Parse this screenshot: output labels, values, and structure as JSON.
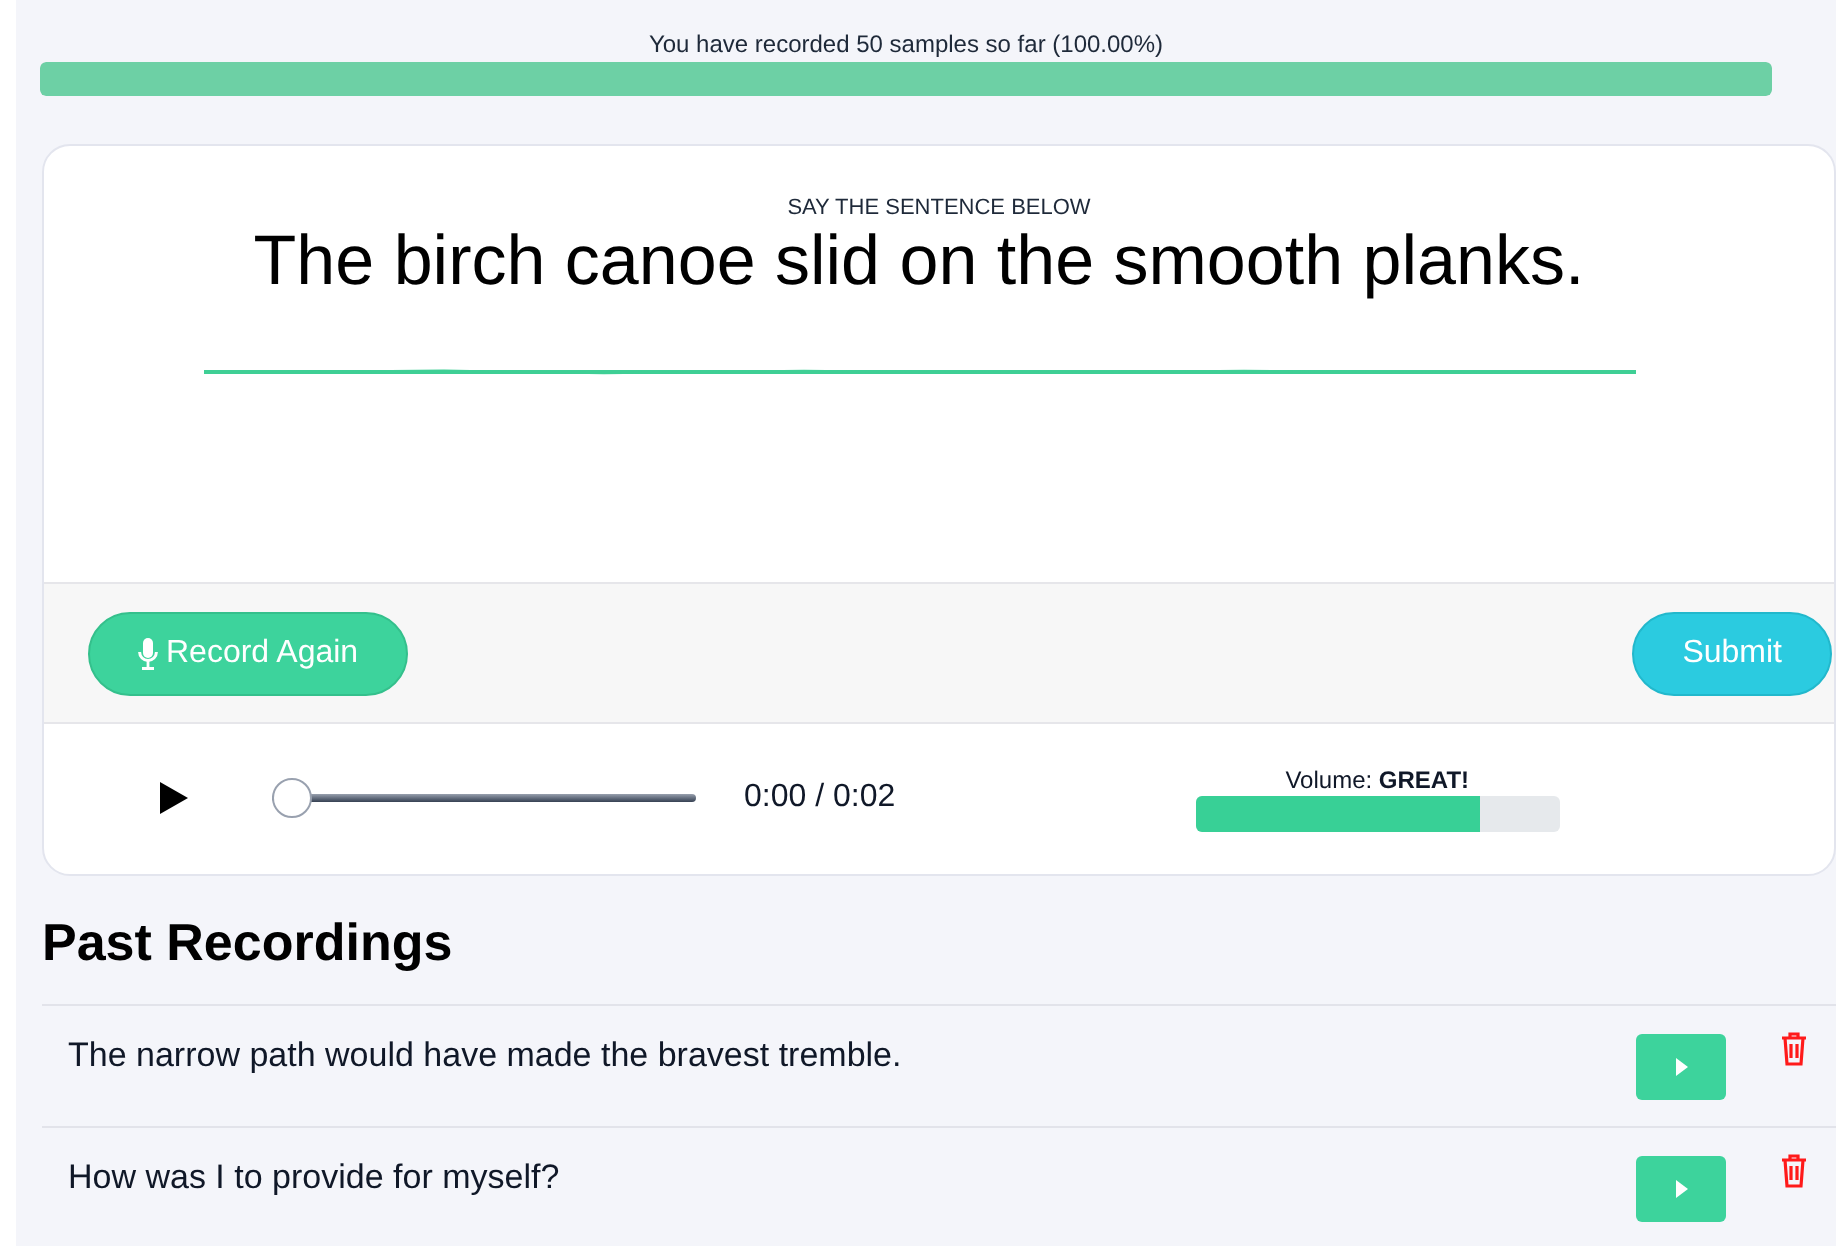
{
  "progress": {
    "label": "You have recorded 50 samples so far (100.00%)",
    "level": 1.0
  },
  "prompt": {
    "caption": "SAY THE SENTENCE BELOW",
    "sentence": "The birch canoe slid on the smooth planks."
  },
  "actions": {
    "record_again": "Record Again",
    "submit": "Submit"
  },
  "player": {
    "position": {
      "level": 0
    },
    "time": "0:00 / 0:02",
    "volume_label": "Volume: **GREAT!**",
    "volume": {
      "level": 0.78
    }
  },
  "past_recordings": {
    "title": "Past Recordings",
    "items": [
      {
        "sentence": "The narrow path would have made the bravest tremble."
      },
      {
        "sentence": "How was I to provide for myself?"
      }
    ]
  }
}
